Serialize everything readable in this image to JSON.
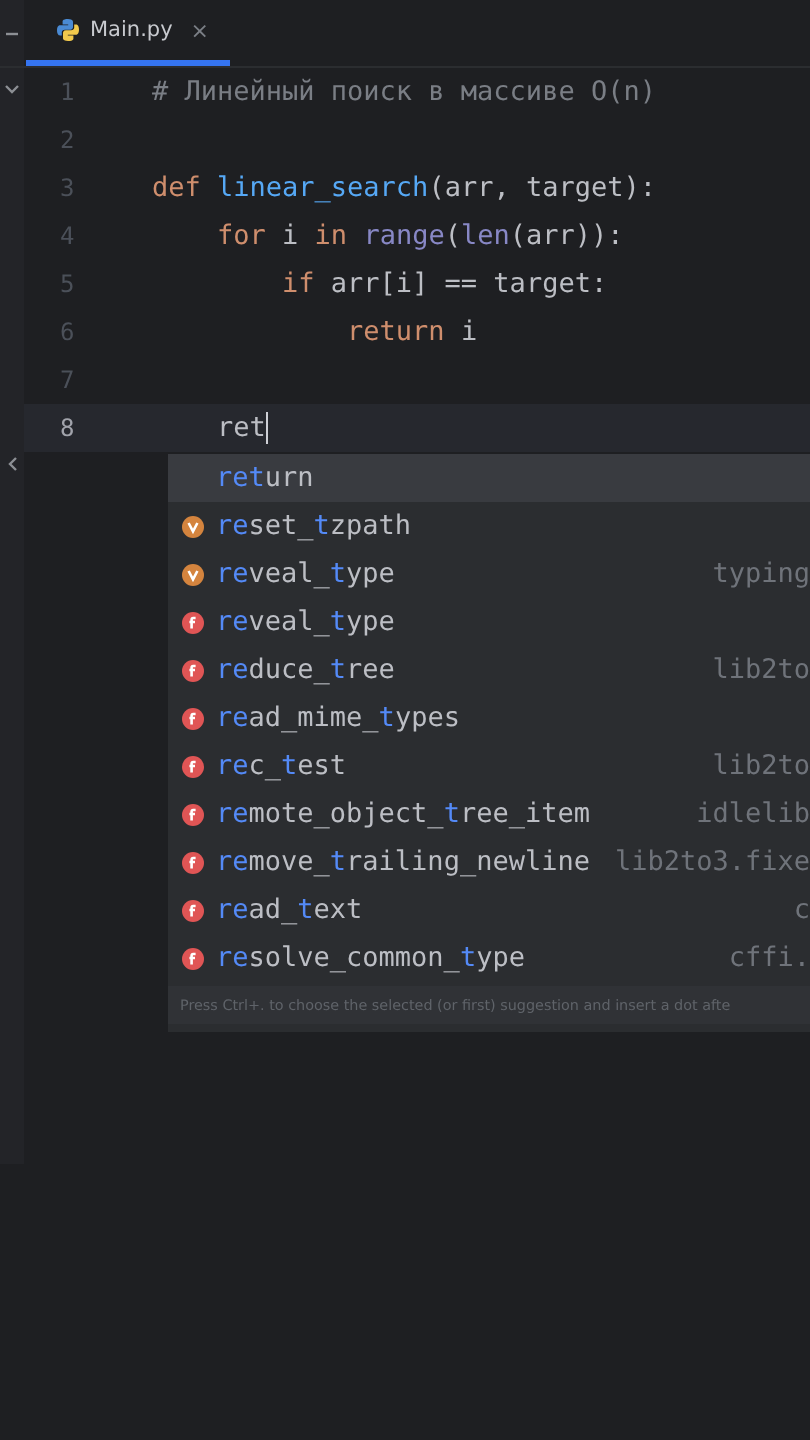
{
  "tab": {
    "label": "Main.py",
    "selected": true,
    "close": "×"
  },
  "lines": [
    {
      "number": "1",
      "current": false,
      "tokens": [
        {
          "text": "# Линейный поиск в массиве O(n)",
          "kind": "comment"
        }
      ]
    },
    {
      "number": "2",
      "current": false
    },
    {
      "number": "3",
      "current": false,
      "tokens": [
        {
          "text": "def ",
          "kind": "keyword"
        },
        {
          "text": "linear_search",
          "kind": "function"
        },
        {
          "text": "(arr, target):",
          "kind": "plain"
        }
      ]
    },
    {
      "number": "4",
      "current": false,
      "tokens": [
        {
          "text": "    for ",
          "kind": "keyword"
        },
        {
          "text": "i ",
          "kind": "plain"
        },
        {
          "text": "in ",
          "kind": "keyword"
        },
        {
          "text": "range",
          "kind": "builtin"
        },
        {
          "text": "(",
          "kind": "plain"
        },
        {
          "text": "len",
          "kind": "builtin"
        },
        {
          "text": "(arr)):",
          "kind": "plain"
        }
      ]
    },
    {
      "number": "5",
      "current": false,
      "tokens": [
        {
          "text": "        if ",
          "kind": "keyword"
        },
        {
          "text": "arr[i] == target:",
          "kind": "plain"
        }
      ]
    },
    {
      "number": "6",
      "current": false,
      "tokens": [
        {
          "text": "            return ",
          "kind": "keyword"
        },
        {
          "text": "i",
          "kind": "plain"
        }
      ]
    },
    {
      "number": "7",
      "current": false
    },
    {
      "number": "8",
      "current": true,
      "tokens": [
        {
          "text": "    ret",
          "kind": "plain"
        }
      ]
    }
  ],
  "completions": [
    {
      "kind": "keyword",
      "selected": true,
      "parts": [
        {
          "text": "ret",
          "match": true
        },
        {
          "text": "urn",
          "match": false
        }
      ]
    },
    {
      "kind": "variable",
      "selected": false,
      "parts": [
        {
          "text": "re",
          "match": true
        },
        {
          "text": "set_",
          "match": false
        },
        {
          "text": "t",
          "match": true
        },
        {
          "text": "zpath",
          "match": false
        }
      ]
    },
    {
      "kind": "variable",
      "selected": false,
      "parts": [
        {
          "text": "re",
          "match": true
        },
        {
          "text": "veal_",
          "match": false
        },
        {
          "text": "t",
          "match": true
        },
        {
          "text": "ype",
          "match": false
        }
      ],
      "source": "typing"
    },
    {
      "kind": "function",
      "selected": false,
      "parts": [
        {
          "text": "re",
          "match": true
        },
        {
          "text": "veal_",
          "match": false
        },
        {
          "text": "t",
          "match": true
        },
        {
          "text": "ype",
          "match": false
        }
      ]
    },
    {
      "kind": "function",
      "selected": false,
      "parts": [
        {
          "text": "re",
          "match": true
        },
        {
          "text": "duce_",
          "match": false
        },
        {
          "text": "t",
          "match": true
        },
        {
          "text": "ree",
          "match": false
        }
      ],
      "source": "lib2to"
    },
    {
      "kind": "function",
      "selected": false,
      "parts": [
        {
          "text": "re",
          "match": true
        },
        {
          "text": "ad_mime_",
          "match": false
        },
        {
          "text": "t",
          "match": true
        },
        {
          "text": "ypes",
          "match": false
        }
      ]
    },
    {
      "kind": "function",
      "selected": false,
      "parts": [
        {
          "text": "re",
          "match": true
        },
        {
          "text": "c_",
          "match": false
        },
        {
          "text": "t",
          "match": true
        },
        {
          "text": "est",
          "match": false
        }
      ],
      "source": "lib2to"
    },
    {
      "kind": "function",
      "selected": false,
      "parts": [
        {
          "text": "re",
          "match": true
        },
        {
          "text": "mote_object_",
          "match": false
        },
        {
          "text": "t",
          "match": true
        },
        {
          "text": "ree_item",
          "match": false
        }
      ],
      "source": "idlelib"
    },
    {
      "kind": "function",
      "selected": false,
      "parts": [
        {
          "text": "re",
          "match": true
        },
        {
          "text": "move_",
          "match": false
        },
        {
          "text": "t",
          "match": true
        },
        {
          "text": "railing_newline",
          "match": false
        }
      ],
      "source": "lib2to3.fixe"
    },
    {
      "kind": "function",
      "selected": false,
      "parts": [
        {
          "text": "re",
          "match": true
        },
        {
          "text": "ad_",
          "match": false
        },
        {
          "text": "t",
          "match": true
        },
        {
          "text": "ext",
          "match": false
        }
      ],
      "source": "c"
    },
    {
      "kind": "function",
      "selected": false,
      "parts": [
        {
          "text": "re",
          "match": true
        },
        {
          "text": "solve_common_",
          "match": false
        },
        {
          "text": "t",
          "match": true
        },
        {
          "text": "ype",
          "match": false
        }
      ],
      "source": "cffi."
    }
  ],
  "hint": "Press Ctrl+. to choose the selected (or first) suggestion and insert a dot afte"
}
